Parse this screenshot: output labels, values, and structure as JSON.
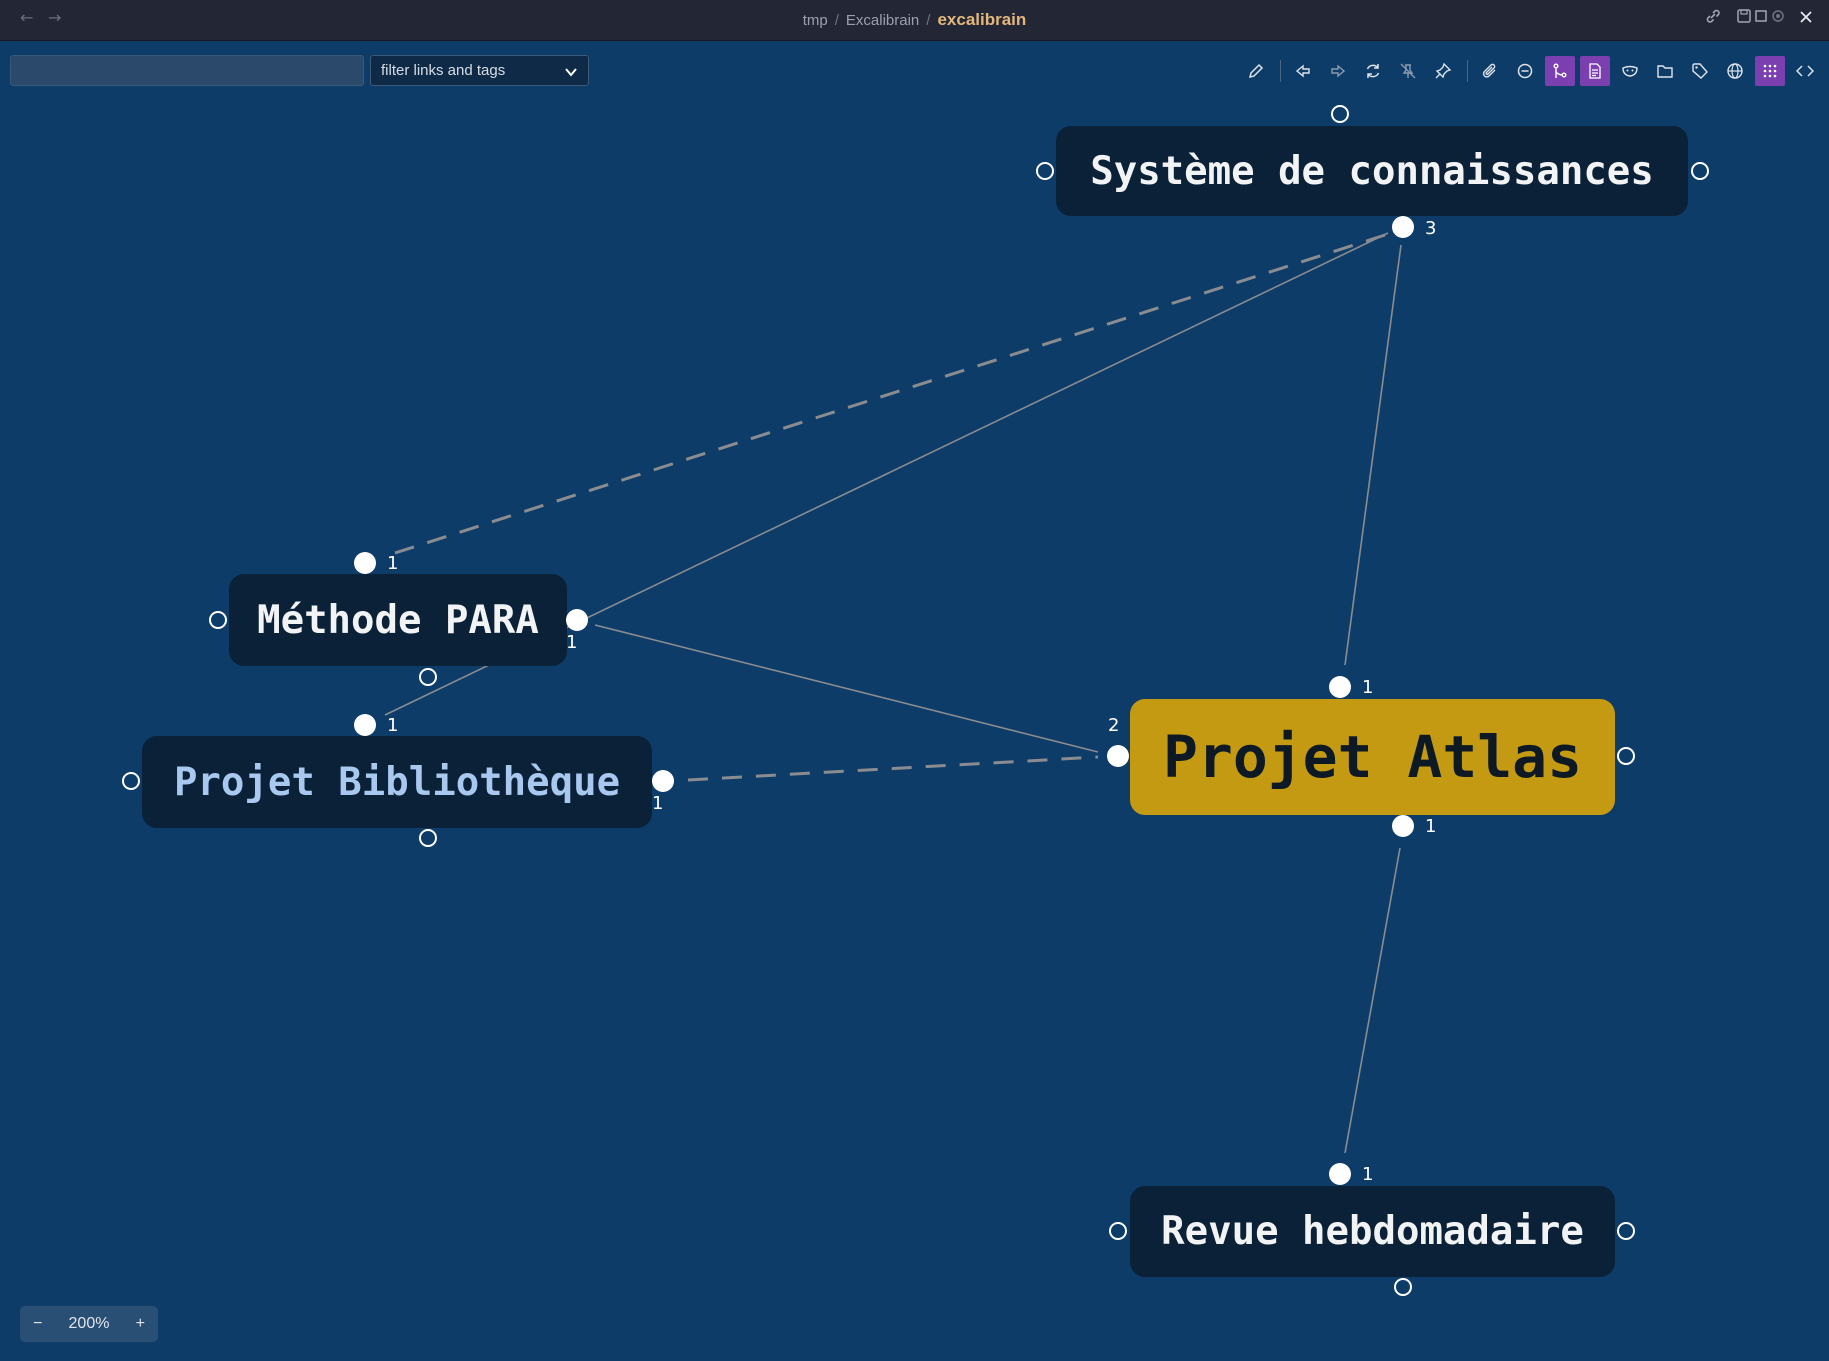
{
  "titlebar": {
    "back_icon": "arrow-left-icon",
    "forward_icon": "arrow-right-icon",
    "breadcrumb": [
      "tmp",
      "Excalibrain",
      "excalibrain"
    ],
    "separator": "/"
  },
  "search": {
    "value": "",
    "placeholder": ""
  },
  "filter": {
    "label": "filter links and tags"
  },
  "toolbar": {
    "items": [
      {
        "icon": "pencil-icon",
        "active": false
      },
      {
        "icon": "navigate-back-icon",
        "active": false
      },
      {
        "icon": "navigate-forward-icon",
        "active": false
      },
      {
        "icon": "refresh-icon",
        "active": false
      },
      {
        "icon": "pin-off-icon",
        "active": false
      },
      {
        "icon": "pin-icon",
        "active": false
      },
      {
        "icon": "attachment-icon",
        "active": false
      },
      {
        "icon": "circle-minus-icon",
        "active": false
      },
      {
        "icon": "branch-icon",
        "active": true
      },
      {
        "icon": "page-icon",
        "active": true
      },
      {
        "icon": "mask-icon",
        "active": false
      },
      {
        "icon": "folder-icon",
        "active": false
      },
      {
        "icon": "tag-icon",
        "active": false
      },
      {
        "icon": "globe-icon",
        "active": false
      },
      {
        "icon": "grid-icon",
        "active": true
      },
      {
        "icon": "code-icon",
        "active": false
      }
    ]
  },
  "graph": {
    "nodes": {
      "systeme": {
        "label": "Système de connaissances",
        "count": "3"
      },
      "methode": {
        "label": "Méthode PARA",
        "count_top": "1",
        "count_right": "1"
      },
      "bibliotheque": {
        "label": "Projet Bibliothèque",
        "count_top": "1",
        "count_right": "1"
      },
      "atlas": {
        "label": "Projet Atlas",
        "count_top": "1",
        "count_left": "2",
        "count_bottom": "1"
      },
      "revue": {
        "label": "Revue hebdomadaire",
        "count_top": "1"
      }
    }
  },
  "zoom": {
    "minus": "−",
    "value": "200%",
    "plus": "+"
  },
  "colors": {
    "canvas": "#0d3c69",
    "node": "#0b2138",
    "central_node": "#c49a12",
    "virtual_text": "#a9c8ef",
    "link": "#8a8c8f",
    "active_button": "#7b3fb0"
  }
}
